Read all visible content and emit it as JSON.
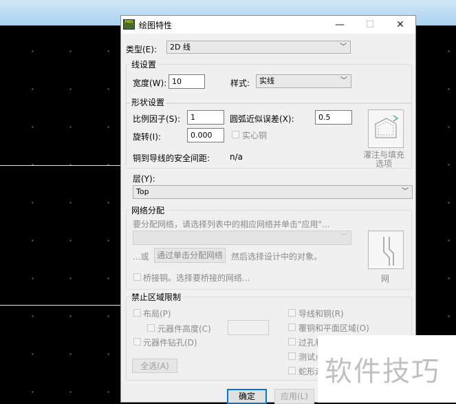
{
  "window": {
    "title": "绘图特性",
    "app_icon_text": "PADS"
  },
  "type_field": {
    "label": "类型(E):",
    "value": "2D 线"
  },
  "line_settings": {
    "legend": "线设置",
    "width_label": "宽度(W):",
    "width_value": "10",
    "style_label": "样式:",
    "style_value": "实线"
  },
  "shape_settings": {
    "legend": "形状设置",
    "scale_label": "比例因子(S):",
    "scale_value": "1",
    "arc_label": "圆弧近似误差(X):",
    "arc_value": "0.5",
    "rotate_label": "旋转(I):",
    "rotate_value": "0.000",
    "solid_copper_label": "实心铜",
    "clearance_label": "铜到导线的安全间距:",
    "clearance_value": "n/a",
    "pour_button_label_1": "灌注与填充",
    "pour_button_label_2": "选项"
  },
  "layer": {
    "label": "层(Y):",
    "value": "Top"
  },
  "net_assign": {
    "legend": "网络分配",
    "hint": "要分配网络，请选择列表中的相应网络并单击\"应用\"...",
    "or_label": "...或",
    "click_assign_button": "通过单击分配网络",
    "then_label": "然后选择设计中的对象。",
    "bridge_label": "桥接铜。选择要桥接的网络...",
    "net_button_label": "网"
  },
  "keepout": {
    "legend": "禁止区域限制",
    "placement": "布局(P)",
    "component_height": "元器件高度(C)",
    "component_drill": "元器件钻孔(D)",
    "select_all": "全选(A)",
    "traces_copper": "导线和铜(R)",
    "pour_plane": "覆铜和平面区域(O)",
    "vias": "过孔和",
    "test_points": "测试点",
    "serpentine": "蛇形走"
  },
  "footer": {
    "ok": "确定",
    "apply": "应用(L)"
  },
  "watermark": "软件技巧"
}
